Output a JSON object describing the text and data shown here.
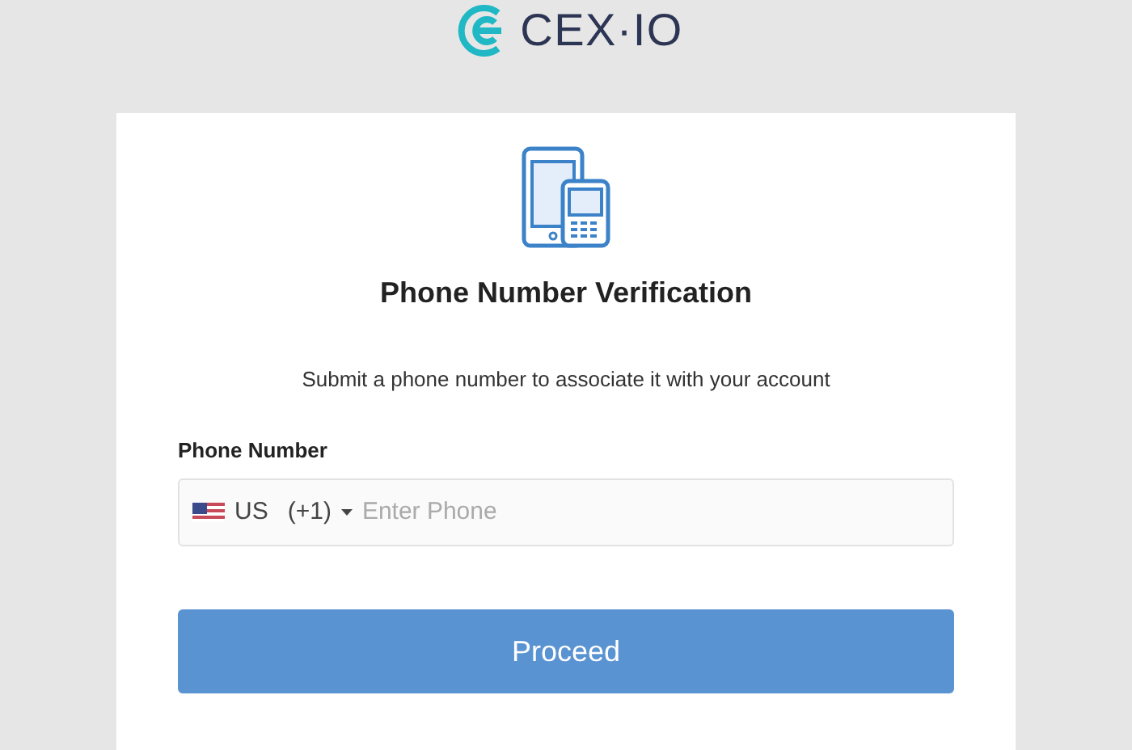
{
  "logo": {
    "text": "CEX·IO"
  },
  "card": {
    "title": "Phone Number Verification",
    "subtitle": "Submit a phone number to associate it with your account",
    "field": {
      "label": "Phone Number",
      "country": "US",
      "code": "(+1)",
      "placeholder": "Enter Phone"
    },
    "button": "Proceed"
  }
}
